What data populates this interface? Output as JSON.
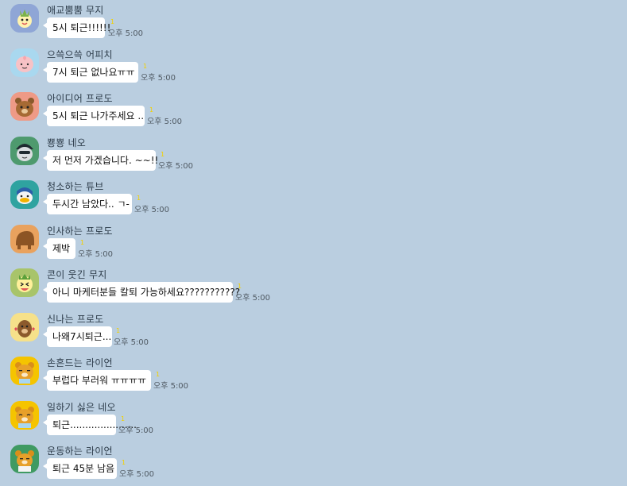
{
  "chat": {
    "messages": [
      {
        "sender": "애교뿜뿜 무지",
        "text": "5시 퇴근!!!!!!",
        "read_count": "1",
        "time": "오후 5:00",
        "avatar_icon": "muzi-cheerful-icon"
      },
      {
        "sender": "으쓱으쓱 어피치",
        "text": "7시 퇴근 없나요ㅠㅠ",
        "read_count": "1",
        "time": "오후 5:00",
        "avatar_icon": "apeach-shrug-icon"
      },
      {
        "sender": "아이디어 프로도",
        "text": "5시 퇴근 나가주세요 ..",
        "read_count": "1",
        "time": "오후 5:00",
        "avatar_icon": "frodo-idea-icon"
      },
      {
        "sender": "뿅뿅 네오",
        "text": "저 먼저 가겠습니다. ~~!!",
        "read_count": "1",
        "time": "오후 5:00",
        "avatar_icon": "neo-bling-icon"
      },
      {
        "sender": "청소하는 튜브",
        "text": "두시간 남았다.. ㄱ-",
        "read_count": "1",
        "time": "오후 5:00",
        "avatar_icon": "tube-cleaning-icon"
      },
      {
        "sender": "인사하는 프로도",
        "text": "제박",
        "read_count": "1",
        "time": "오후 5:00",
        "avatar_icon": "frodo-bowing-icon"
      },
      {
        "sender": "콘이 웃긴 무지",
        "text": "아니 마케터분들 칼퇴 가능하세요???????????",
        "read_count": "1",
        "time": "오후 5:00",
        "avatar_icon": "muzi-laughing-icon"
      },
      {
        "sender": "신나는 프로도",
        "text": "나왜7시퇴근...",
        "read_count": "1",
        "time": "오후 5:00",
        "avatar_icon": "frodo-excited-icon"
      },
      {
        "sender": "손흔드는 라이언",
        "text": "부럽다 부러워 ㅠㅠㅠㅠ",
        "read_count": "1",
        "time": "오후 5:00",
        "avatar_icon": "ryan-waving-icon"
      },
      {
        "sender": "일하기 싫은 네오",
        "text": "퇴근......................",
        "read_count": "1",
        "time": "오후 5:00",
        "avatar_icon": "ryan-tired-icon"
      },
      {
        "sender": "운동하는 라이언",
        "text": "퇴근 45분 남음",
        "read_count": "1",
        "time": "오후 5:00",
        "avatar_icon": "ryan-exercise-icon"
      }
    ]
  },
  "colors": {
    "background": "#bacee0",
    "bubble": "#ffffff",
    "unread": "#f2d100"
  }
}
